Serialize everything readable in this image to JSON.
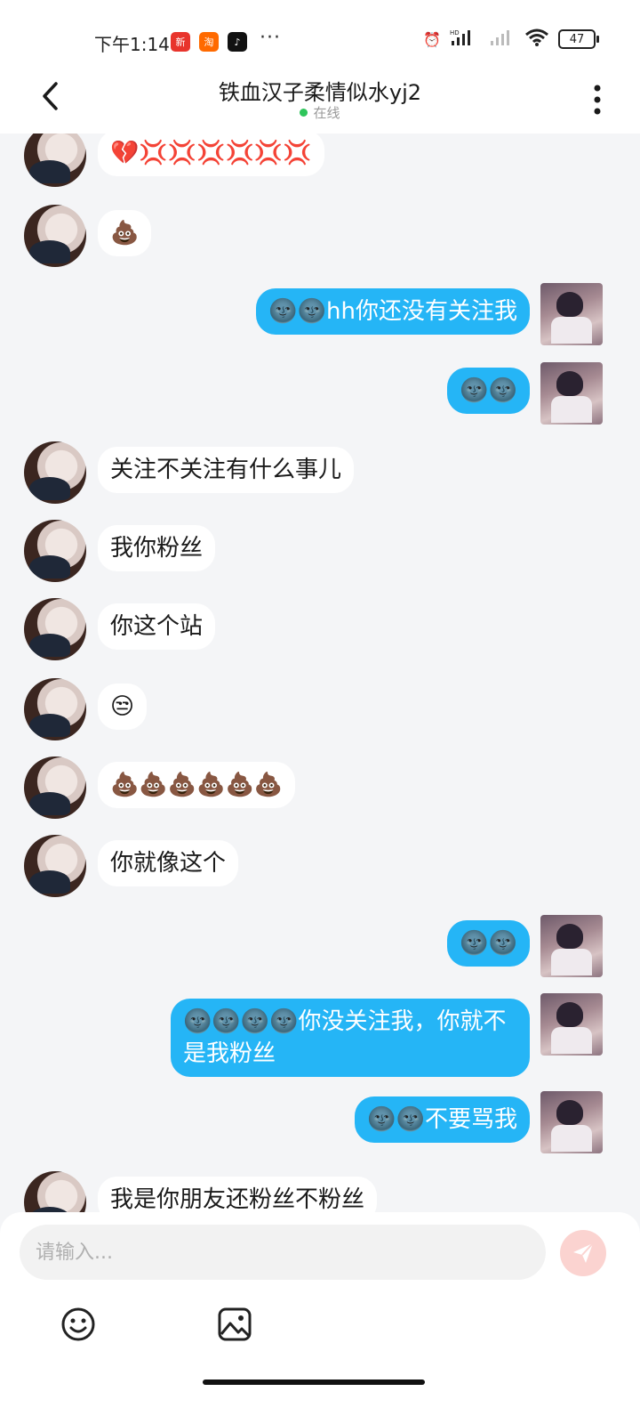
{
  "status_bar": {
    "time": "下午1:14",
    "apps": [
      "新",
      "淘",
      "♪"
    ],
    "more": "···",
    "alarm": "⏰",
    "hd": "HD",
    "battery": "47"
  },
  "header": {
    "title": "铁血汉子柔情似水yj2",
    "status": "在线"
  },
  "messages": [
    {
      "side": "left",
      "text": "💔💢💢💢💢💢💢"
    },
    {
      "side": "left",
      "text": "💩"
    },
    {
      "side": "right",
      "text": "🌚🌚hh你还没有关注我"
    },
    {
      "side": "right",
      "text": "🌚🌚"
    },
    {
      "side": "left",
      "text": "关注不关注有什么事儿"
    },
    {
      "side": "left",
      "text": "我你粉丝"
    },
    {
      "side": "left",
      "text": "你这个站"
    },
    {
      "side": "left",
      "text": "😒"
    },
    {
      "side": "left",
      "text": "💩💩💩💩💩💩"
    },
    {
      "side": "left",
      "text": "你就像这个"
    },
    {
      "side": "right",
      "text": "🌚🌚"
    },
    {
      "side": "right",
      "text": "🌚🌚🌚🌚你没关注我，你就不是我粉丝"
    },
    {
      "side": "right",
      "text": "🌚🌚不要骂我"
    },
    {
      "side": "left",
      "text": "我是你朋友还粉丝不粉丝"
    }
  ],
  "input": {
    "placeholder": "请输入..."
  }
}
